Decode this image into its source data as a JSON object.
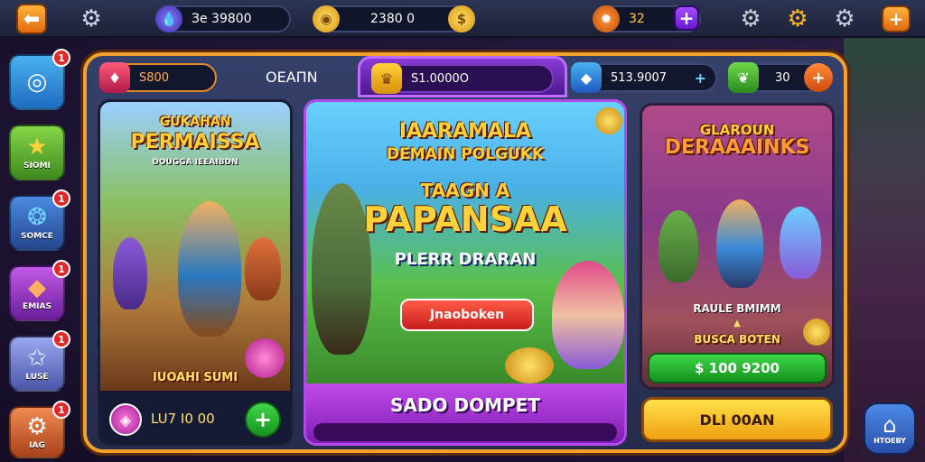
{
  "topbar": {
    "gem_value": "Зe 39800",
    "coin_value": "2380 0",
    "energy_value": "32"
  },
  "sidebar": {
    "items": [
      {
        "label": "",
        "badge": "1",
        "icon": "orb-icon",
        "color": "#3aa0e8"
      },
      {
        "label": "SIOMI",
        "badge": "",
        "icon": "star-icon",
        "color": "#6fc03a"
      },
      {
        "label": "SOMCE",
        "badge": "1",
        "icon": "ring-icon",
        "color": "#4a8adf"
      },
      {
        "label": "EMIAS",
        "badge": "1",
        "icon": "gem-icon",
        "color": "#b04ad8"
      },
      {
        "label": "LUSE",
        "badge": "1",
        "icon": "star-outline-icon",
        "color": "#8a9fe0"
      },
      {
        "label": "IAG",
        "badge": "1",
        "icon": "gear-icon",
        "color": "#e07040"
      }
    ]
  },
  "panel": {
    "tab1_value": "S800",
    "tab_label": "OEAПN",
    "tab2_value": "S1.0000O",
    "tab3_value": "513.9007",
    "tab4_value": "30"
  },
  "card_left": {
    "title_top": "GUKAHAN",
    "title_main": "PERMAISSA",
    "subtitle": "DOUGGA IEEAIBDN",
    "caption": "IUOAHI SUMI",
    "amount": "LU7 I0 00"
  },
  "card_center": {
    "title_line1": "IAARAMALA",
    "title_line2": "DEMAIN POLGUKK",
    "title_line3": "TAAGN A",
    "title_main": "PAPANSAA",
    "subtitle": "PLERR DRARAN",
    "cta_label": "Jnaoboken",
    "footer_label": "SADO DOMPET"
  },
  "card_right": {
    "title_top": "GLAROUN",
    "title_main": "DERAAAINKS",
    "caption": "RAULE BMIMM",
    "caption2": "BUSCA BOTEN",
    "price_label": "$ 100 9200",
    "button_label": "DLI 00AN"
  },
  "home": {
    "label": "HTOEBY"
  }
}
